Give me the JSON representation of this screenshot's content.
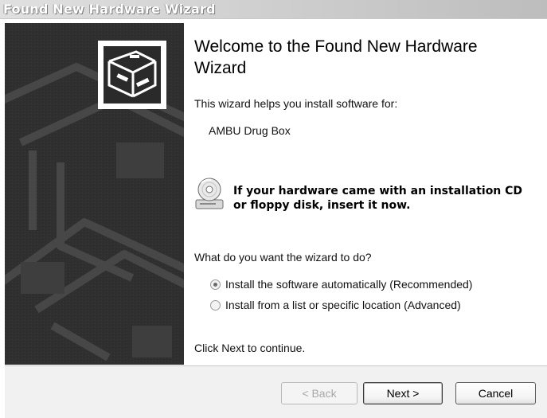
{
  "window": {
    "title": "Found New Hardware Wizard"
  },
  "main": {
    "heading": "Welcome to the Found New Hardware Wizard",
    "intro": "This wizard helps you install software for:",
    "device_name": "AMBU Drug Box",
    "cd_prompt_line1": "If your hardware came with an installation CD",
    "cd_prompt_line2": "or floppy disk, insert it now.",
    "question": "What do you want the wizard to do?",
    "options": [
      {
        "label": "Install the software automatically (Recommended)",
        "selected": true
      },
      {
        "label": "Install from a list or specific location (Advanced)",
        "selected": false
      }
    ],
    "continue_hint": "Click Next to continue."
  },
  "footer": {
    "back_label": "< Back",
    "next_label": "Next >",
    "cancel_label": "Cancel"
  },
  "icons": {
    "wizard": "hardware-wizard-icon",
    "cd": "cd-drive-icon"
  }
}
